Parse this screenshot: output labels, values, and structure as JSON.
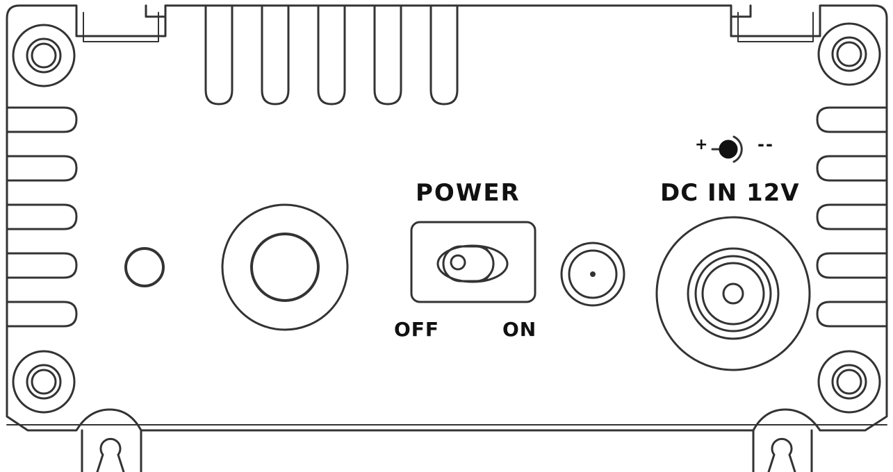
{
  "colors": {
    "stroke": "#333333",
    "background": "#ffffff",
    "text": "#111111"
  },
  "labels": {
    "power": "POWER",
    "off": "OFF",
    "on": "ON",
    "dc_in": "DC IN 12V"
  },
  "polarity": {
    "plus": "+",
    "minus": "--",
    "icon": "center-positive-polarity-icon"
  },
  "switch": {
    "state": "OFF"
  }
}
